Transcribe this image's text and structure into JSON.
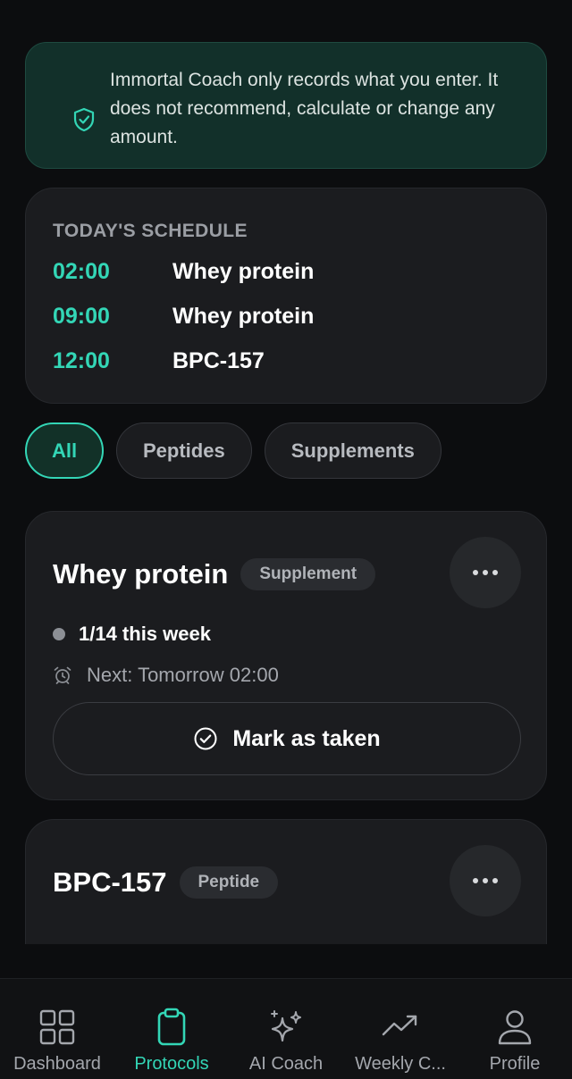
{
  "disclaimer": {
    "text": "Immortal Coach only records what you enter. It does not recommend, calculate or change any amount.",
    "icon": "shield-check-icon"
  },
  "schedule": {
    "heading": "TODAY'S SCHEDULE",
    "items": [
      {
        "time": "02:00",
        "name": "Whey protein"
      },
      {
        "time": "09:00",
        "name": "Whey protein"
      },
      {
        "time": "12:00",
        "name": "BPC-157"
      }
    ]
  },
  "filters": {
    "chips": [
      "All",
      "Peptides",
      "Supplements"
    ],
    "selected": "All"
  },
  "protocols": [
    {
      "name": "Whey protein",
      "type": "Supplement",
      "progress": "1/14 this week",
      "next": "Next: Tomorrow 02:00",
      "action_label": "Mark as taken"
    },
    {
      "name": "BPC-157",
      "type": "Peptide"
    }
  ],
  "nav": {
    "items": [
      {
        "label": "Dashboard",
        "icon": "grid-icon"
      },
      {
        "label": "Protocols",
        "icon": "clipboard-icon"
      },
      {
        "label": "AI Coach",
        "icon": "sparkles-icon"
      },
      {
        "label": "Weekly C...",
        "icon": "trend-up-icon"
      },
      {
        "label": "Profile",
        "icon": "user-icon"
      }
    ],
    "active": "Protocols"
  },
  "colors": {
    "accent": "#33d6b6",
    "background": "#0c0d0f",
    "card": "#1b1c1f",
    "banner": "#12302a"
  }
}
